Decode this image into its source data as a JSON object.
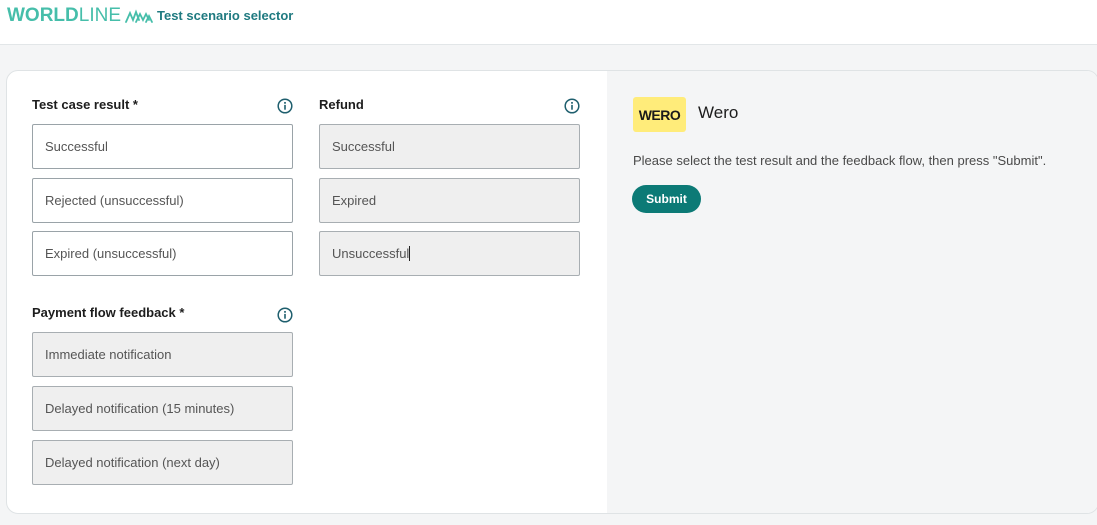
{
  "header": {
    "logo_text_bold": "WORLD",
    "logo_text_light": "LINE",
    "app_title": "Test scenario selector"
  },
  "test_case_result": {
    "label": "Test case result *",
    "options": [
      "Successful",
      "Rejected (unsuccessful)",
      "Expired (unsuccessful)"
    ]
  },
  "payment_flow_feedback": {
    "label": "Payment flow feedback *",
    "options": [
      "Immediate notification",
      "Delayed notification (15 minutes)",
      "Delayed notification (next day)"
    ]
  },
  "refund": {
    "label": "Refund",
    "options": [
      "Successful",
      "Expired",
      "Unsuccessful"
    ]
  },
  "summary": {
    "payment_method_logo": "WERO",
    "payment_method_name": "Wero",
    "instructions": "Please select the test result and the feedback flow, then press \"Submit\".",
    "submit_label": "Submit"
  },
  "icons": {
    "info": "info-circle-icon",
    "brand": "worldline-waves-icon"
  },
  "colors": {
    "brand_teal": "#46beaa",
    "title_teal": "#1f7a80",
    "submit_bg": "#0c7a76",
    "wero_yellow": "#ffec7a",
    "disabled_bg": "#efefef"
  }
}
